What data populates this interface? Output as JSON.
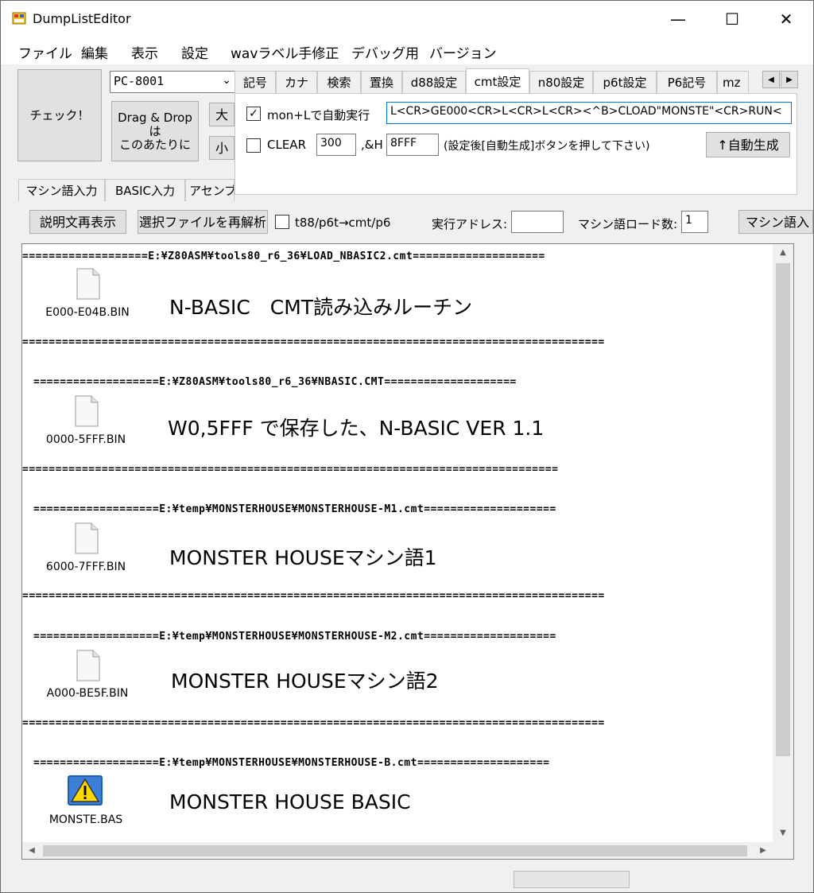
{
  "window": {
    "title": "DumpListEditor",
    "minimize": "—",
    "maximize": "☐",
    "close": "✕"
  },
  "menu": [
    "ファイル",
    "編集",
    "表示",
    "設定",
    "wavラベル手修正",
    "デバッグ用",
    "バージョン"
  ],
  "toolbar": {
    "check_label": "チェック！",
    "machine": "PC-8001",
    "drag_drop_line1": "Drag & Drop",
    "drag_drop_line2": "は",
    "drag_drop_line3": "このあたりに",
    "big_label": "大",
    "small_label": "小"
  },
  "top_tabs": [
    "記号",
    "カナ",
    "検索",
    "置換",
    "d88設定",
    "cmt設定",
    "n80設定",
    "p6t設定",
    "P6記号",
    "mz"
  ],
  "top_tab_selected": "cmt設定",
  "cmt_panel": {
    "auto_run_checked": "✓",
    "auto_run_label": "mon+Lで自動実行",
    "auto_run_command": "L<CR>GE000<CR>L<CR>L<CR><^B>CLOAD\"MONSTE\"<CR>RUN<",
    "clear_checked": "",
    "clear_label": "CLEAR",
    "clear_value": "300",
    "h_label": ",&H",
    "h_value": "8FFF",
    "note": "(設定後[自動生成]ボタンを押して下さい)",
    "autogen_button": "↑自動生成"
  },
  "lower_tabs": [
    "マシン語入力",
    "BASIC入力",
    "アセンブ"
  ],
  "action_bar": {
    "redisplay_button": "説明文再表示",
    "reparse_button": "選択ファイルを再解析",
    "convert_checked": "",
    "convert_label": "t88/p6t→cmt/p6",
    "exec_addr_label": "実行アドレス:",
    "exec_addr_value": "",
    "load_count_label": "マシン語ロード数:",
    "load_count_value": "1",
    "machine_input_button": "マシン語入"
  },
  "entries": [
    {
      "header": "===================E:¥Z80ASM¥tools80_r6_36¥LOAD_NBASIC2.cmt====================",
      "file": "E000-E04B.BIN",
      "title": "N-BASIC　CMT読み込みルーチン",
      "footer": "========================================================================================",
      "icon": "file-icon"
    },
    {
      "header": "===================E:¥Z80ASM¥tools80_r6_36¥NBASIC.CMT====================",
      "file": "0000-5FFF.BIN",
      "title": "W0,5FFF で保存した、N-BASIC VER 1.1",
      "footer": "=================================================================================",
      "icon": "file-icon"
    },
    {
      "header": "===================E:¥temp¥MONSTERHOUSE¥MONSTERHOUSE-M1.cmt====================",
      "file": "6000-7FFF.BIN",
      "title": "MONSTER HOUSEマシン語1",
      "footer": "========================================================================================",
      "icon": "file-icon"
    },
    {
      "header": "===================E:¥temp¥MONSTERHOUSE¥MONSTERHOUSE-M2.cmt====================",
      "file": "A000-BE5F.BIN",
      "title": "MONSTER HOUSEマシン語2",
      "footer": "========================================================================================",
      "icon": "file-icon"
    },
    {
      "header": "===================E:¥temp¥MONSTERHOUSE¥MONSTERHOUSE-B.cmt====================",
      "file": "MONSTE.BAS",
      "title": "MONSTER HOUSE BASIC",
      "footer": "",
      "icon": "warning-icon"
    }
  ],
  "scroll": {
    "up": "▲",
    "down": "▼",
    "left": "◀",
    "right": "▶",
    "tab_left": "◀",
    "tab_right": "▶"
  }
}
